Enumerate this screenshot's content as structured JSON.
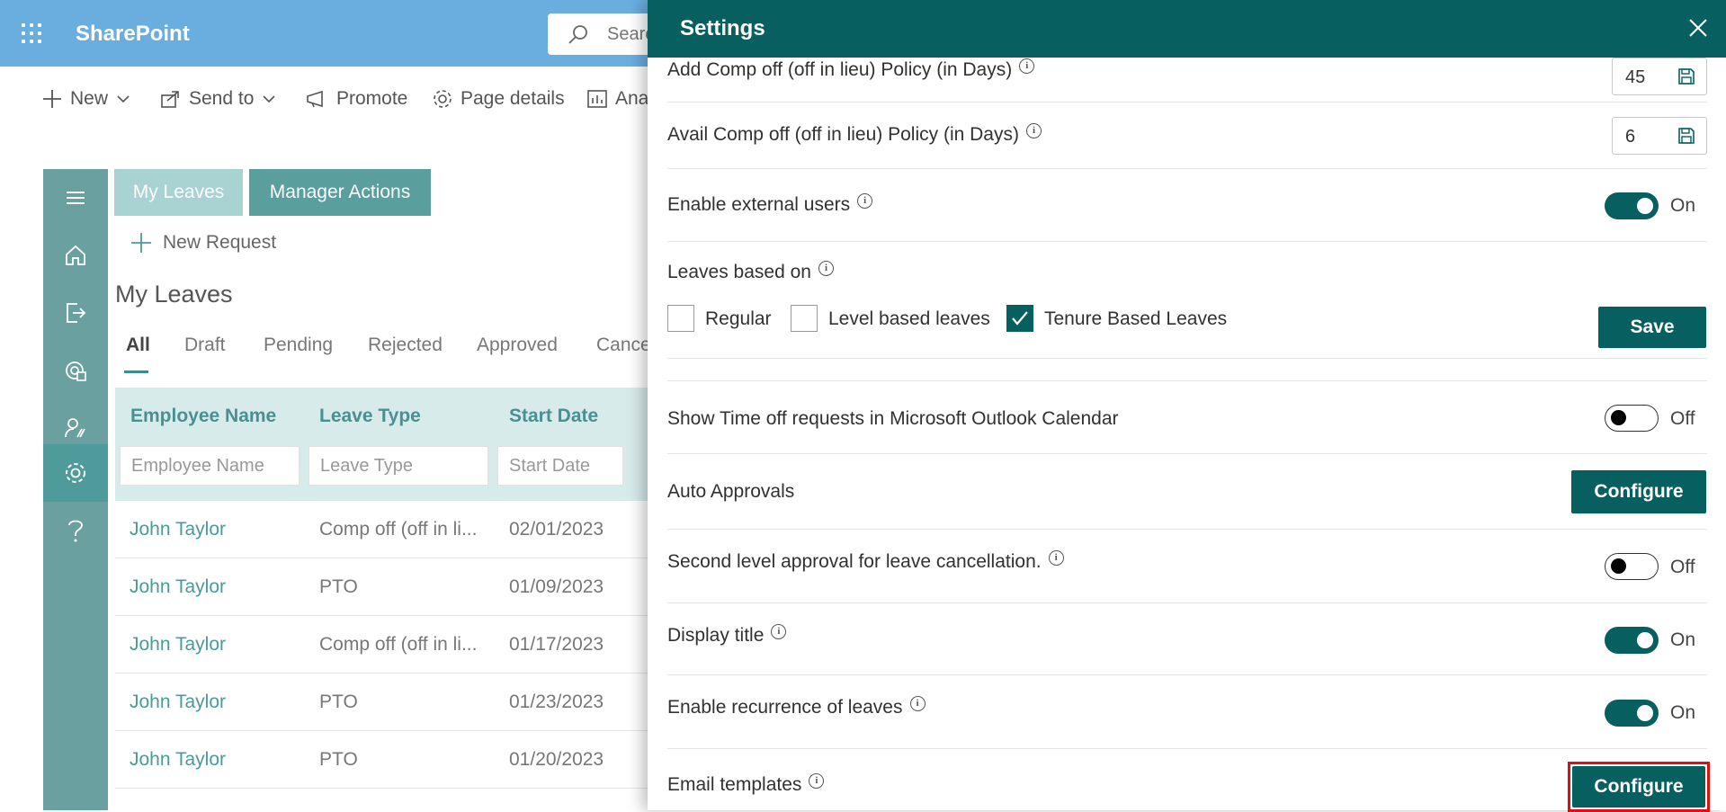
{
  "app": {
    "name": "SharePoint",
    "search_placeholder": "Search"
  },
  "commands": [
    {
      "label": "New",
      "icon": "plus-icon"
    },
    {
      "label": "Send to",
      "icon": "share-icon"
    },
    {
      "label": "Promote",
      "icon": "megaphone-icon"
    },
    {
      "label": "Page details",
      "icon": "gear-icon"
    },
    {
      "label": "Analytics",
      "icon": "chart-icon"
    }
  ],
  "rail": [
    "menu-icon",
    "home-icon",
    "sign-out-icon",
    "reports-icon",
    "user-settings-icon",
    "gear-icon",
    "help-icon"
  ],
  "tabs": {
    "my_leaves": "My Leaves",
    "manager_actions": "Manager Actions"
  },
  "new_request": "New Request",
  "section_title": "My Leaves",
  "filters": [
    "All",
    "Draft",
    "Pending",
    "Rejected",
    "Approved",
    "Cancelled"
  ],
  "table": {
    "columns": [
      "Employee Name",
      "Leave Type",
      "Start Date"
    ],
    "placeholders": [
      "Employee Name",
      "Leave Type",
      "Start Date"
    ],
    "rows": [
      {
        "name": "John Taylor",
        "type": "Comp off (off in li...",
        "start": "02/01/2023"
      },
      {
        "name": "John Taylor",
        "type": "PTO",
        "start": "01/09/2023"
      },
      {
        "name": "John Taylor",
        "type": "Comp off (off in li...",
        "start": "01/17/2023"
      },
      {
        "name": "John Taylor",
        "type": "PTO",
        "start": "01/23/2023"
      },
      {
        "name": "John Taylor",
        "type": "PTO",
        "start": "01/20/2023"
      }
    ]
  },
  "settings": {
    "title": "Settings",
    "add_comp_off": {
      "label": "Add Comp off (off in lieu) Policy (in Days)",
      "value": "45"
    },
    "avail_comp_off": {
      "label": "Avail Comp off (off in lieu) Policy (in Days)",
      "value": "6"
    },
    "external_users": {
      "label": "Enable external users",
      "state": "On"
    },
    "leaves_based_on": {
      "label": "Leaves based on",
      "options": [
        {
          "label": "Regular",
          "checked": false
        },
        {
          "label": "Level based leaves",
          "checked": false
        },
        {
          "label": "Tenure Based Leaves",
          "checked": true
        }
      ],
      "save_label": "Save"
    },
    "outlook": {
      "label": "Show Time off requests in Microsoft Outlook Calendar",
      "state": "Off"
    },
    "auto_approvals": {
      "label": "Auto Approvals",
      "button": "Configure"
    },
    "second_level": {
      "label": "Second level approval for leave cancellation.",
      "state": "Off"
    },
    "display_title": {
      "label": "Display title",
      "state": "On"
    },
    "recurrence": {
      "label": "Enable recurrence of leaves",
      "state": "On"
    },
    "email_templates": {
      "label": "Email templates",
      "button": "Configure"
    }
  },
  "colors": {
    "header": "#075f5f",
    "brand_bar": "#6aaee0",
    "rail": "#6aa0a0",
    "highlight": "#e01010"
  }
}
